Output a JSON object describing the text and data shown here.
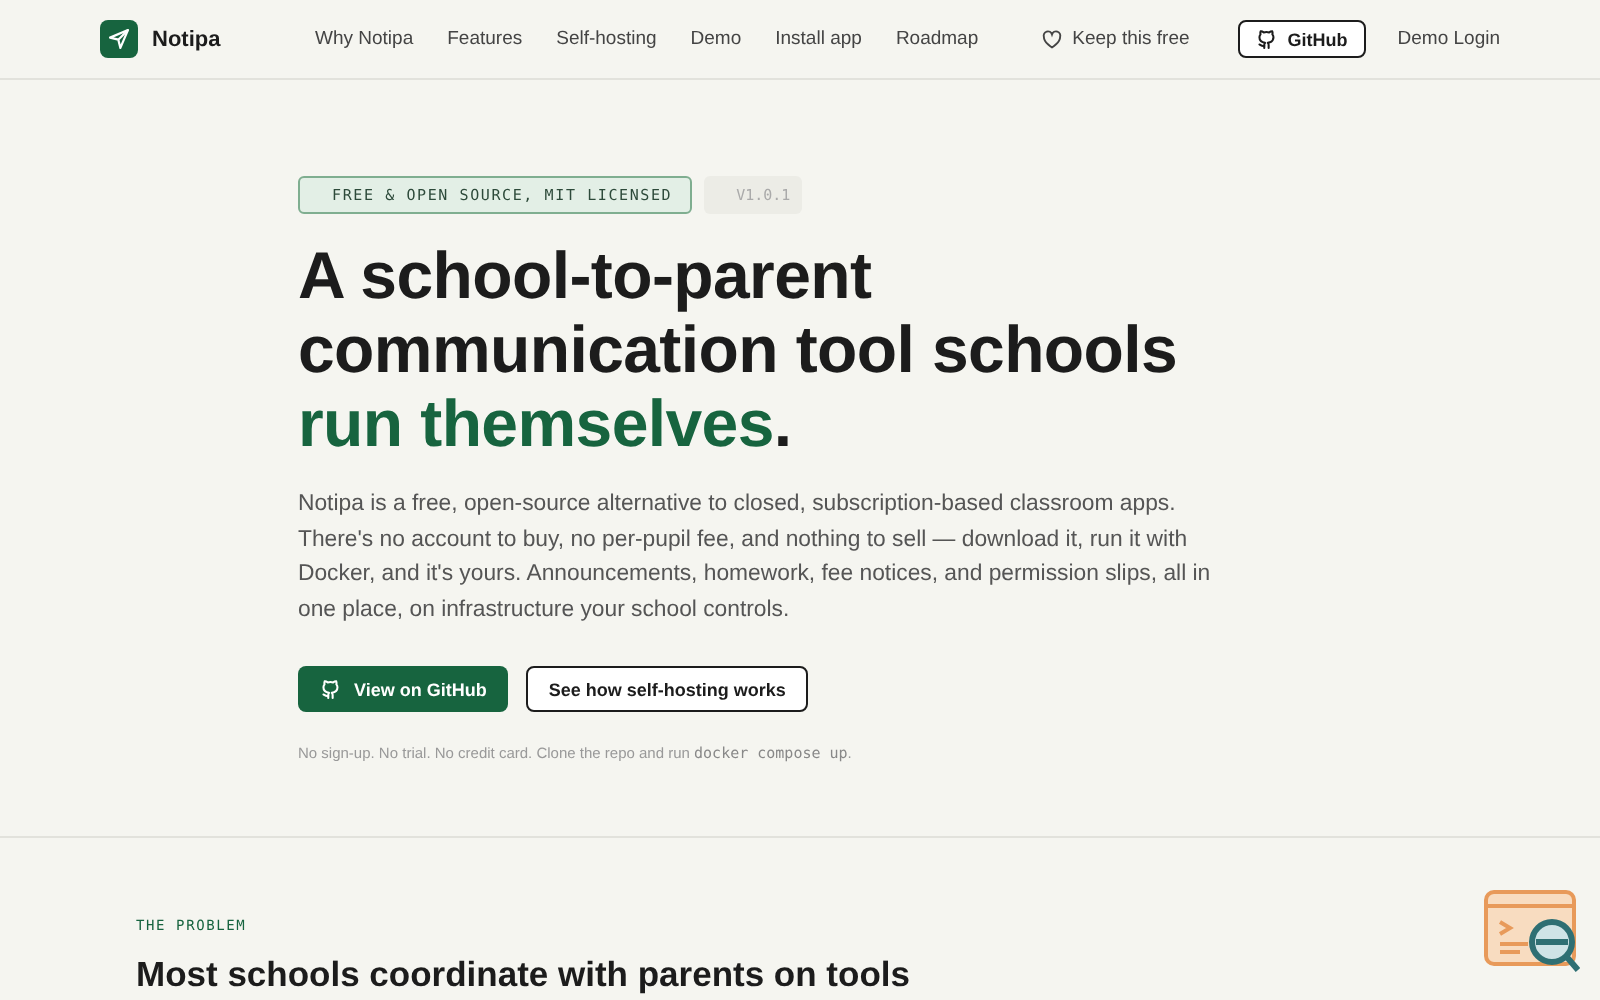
{
  "brand": {
    "name": "Notipa"
  },
  "nav": {
    "links": [
      "Why Notipa",
      "Features",
      "Self-hosting",
      "Demo",
      "Install app",
      "Roadmap"
    ],
    "support": "Keep this free",
    "github": "GitHub",
    "login": "Demo Login"
  },
  "hero": {
    "badge": "FREE & OPEN SOURCE, MIT LICENSED",
    "version": "V1.0.1",
    "heading_lead": "A school-to-parent communication tool schools ",
    "heading_accent": "run themselves",
    "heading_end": ".",
    "intro": "Notipa is a free, open-source alternative to closed, subscription-based classroom apps. There's no account to buy, no per-pupil fee, and nothing to sell — download it, run it with Docker, and it's yours. Announcements, homework, fee notices, and permission slips, all in one place, on infrastructure your school controls.",
    "primary_button": "View on GitHub",
    "secondary_button": "See how self-hosting works",
    "note": "No sign-up. No trial. No credit card. Clone the repo and run ",
    "note_code": "docker compose up",
    "note_end": "."
  },
  "problem": {
    "eyebrow": "THE PROBLEM",
    "heading": "Most schools coordinate with parents on tools"
  }
}
